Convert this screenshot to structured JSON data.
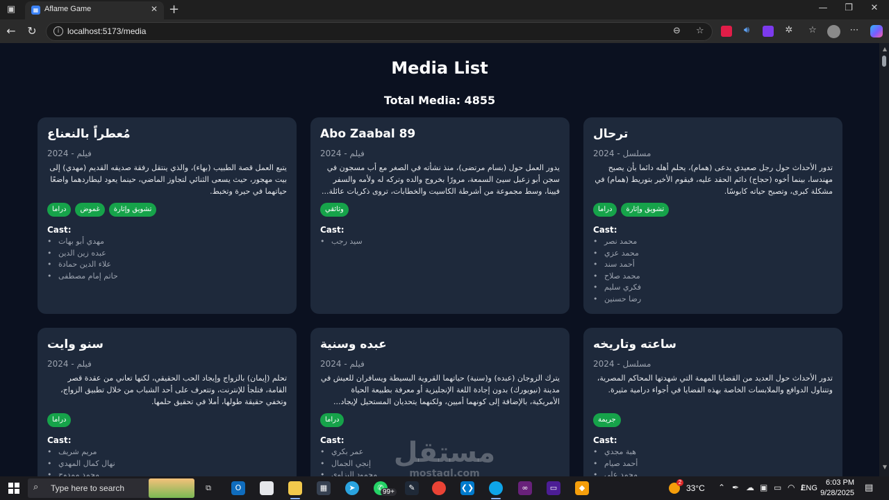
{
  "browser": {
    "tab_title": "Aflame Game",
    "url": "localhost:5173/media"
  },
  "page": {
    "title": "Media List",
    "total": "Total Media: 4855"
  },
  "cards": [
    {
      "title": "مُعطراً بالنعناع",
      "meta": "فيلم - 2024",
      "desc": "يتبع العمل قصة الطبيب (بهاء)، والذي ينتقل رفقة صديقه القديم (مهدي) إلى بيت مهجور، حيث يسعى الثنائي لتجاوز الماضي، حينما يعود ليطاردهما واضعًا حياتهما في حيرة وتخبط.",
      "tags": [
        "دراما",
        "غموض",
        "تشويق وإثارة"
      ],
      "cast_label": "Cast:",
      "cast": [
        "مهدي أبو بهات",
        "عبده زين الدين",
        "علاء الدين حمادة",
        "حاتم إمام مصطفى"
      ]
    },
    {
      "title": "Abo Zaabal 89",
      "meta": "فيلم - 2024",
      "desc": "يدور العمل حول (بسام مرتضى)، منذ نشأته في الصغر مع أب مسجون في سجن أبو زعبل سيئ السمعة، مرورًا بخروج والده وتركه له ولأمه والسفر فيينا، وسط مجموعة من أشرطة الكاسيت والخطابات، تروى ذكريات عائلة...",
      "tags": [
        "وثائقي"
      ],
      "cast_label": "Cast:",
      "cast": [
        "سيد رجب"
      ]
    },
    {
      "title": "ترحال",
      "meta": "مسلسل - 2024",
      "desc": "تدور الأحداث حول رجل صعيدي يدعى (همام)، يحلم أهله دائما بأن يصبح مهندسا، بينما أخوه (حجاج) دائم الحقد عليه، فيقوم الأخير بتوريط (همام) في مشكلة كبرى، وتصبح حياته كابوسًا.",
      "tags": [
        "دراما",
        "تشويق وإثارة"
      ],
      "cast_label": "Cast:",
      "cast": [
        "محمد نصر",
        "محمد عزي",
        "أحمد سند",
        "محمد صلاح",
        "فكري سليم",
        "رضا حسنين"
      ]
    },
    {
      "title": "سنو وايت",
      "meta": "فيلم - 2024",
      "desc": "تحلم (إيمان) بالزواج وإيجاد الحب الحقيقي، لكنها تعاني من عقدة قصر القامة، فتلجأ للإنترنت، وتتعرف على أحد الشباب من خلال تطبيق الزواج، وتخفي حقيقة طولها، أملا في تحقيق حلمها.",
      "tags": [
        "دراما"
      ],
      "cast_label": "Cast:",
      "cast": [
        "مريم شريف",
        "نهال كمال المهدي",
        "محمد ممدوح"
      ]
    },
    {
      "title": "عبده وسنية",
      "meta": "فيلم - 2024",
      "desc": "يترك الزوجان (عبده) و(سنية) حياتهما القروية البسيطة ويسافران للعيش في مدينة (نيويورك) بدون إجادة اللغة الإنجليزية أو معرفة بطبيعة الحياة الأمريكية، بالإضافة إلى كونهما أميين، ولكنهما يتحديان المستحيل لإيجاد...",
      "tags": [
        "دراما"
      ],
      "cast_label": "Cast:",
      "cast": [
        "عمر بكري",
        "إنجي الجمال",
        "محمود البزاوي"
      ]
    },
    {
      "title": "ساعته وتاريخه",
      "meta": "مسلسل - 2024",
      "desc": "تدور الأحداث حول العديد من القضايا المهمة التي شهدتها المحاكم المصرية، وتتناول الدوافع والملابسات الخاصة بهذه القضايا في أجواء درامية مثيرة.",
      "tags": [
        "جريمة"
      ],
      "cast_label": "Cast:",
      "cast": [
        "هبة مجدي",
        "أحمد صيام",
        "محمد علي"
      ]
    }
  ],
  "watermark": {
    "ar": "مستقل",
    "en": "mostaql.com"
  },
  "taskbar": {
    "search_placeholder": "Type here to search",
    "badge_whatsapp": "99+",
    "weather_temp": "33°C",
    "weather_badge": "2",
    "lang": "ENG",
    "time": "6:03 PM",
    "date": "9/28/2025"
  }
}
